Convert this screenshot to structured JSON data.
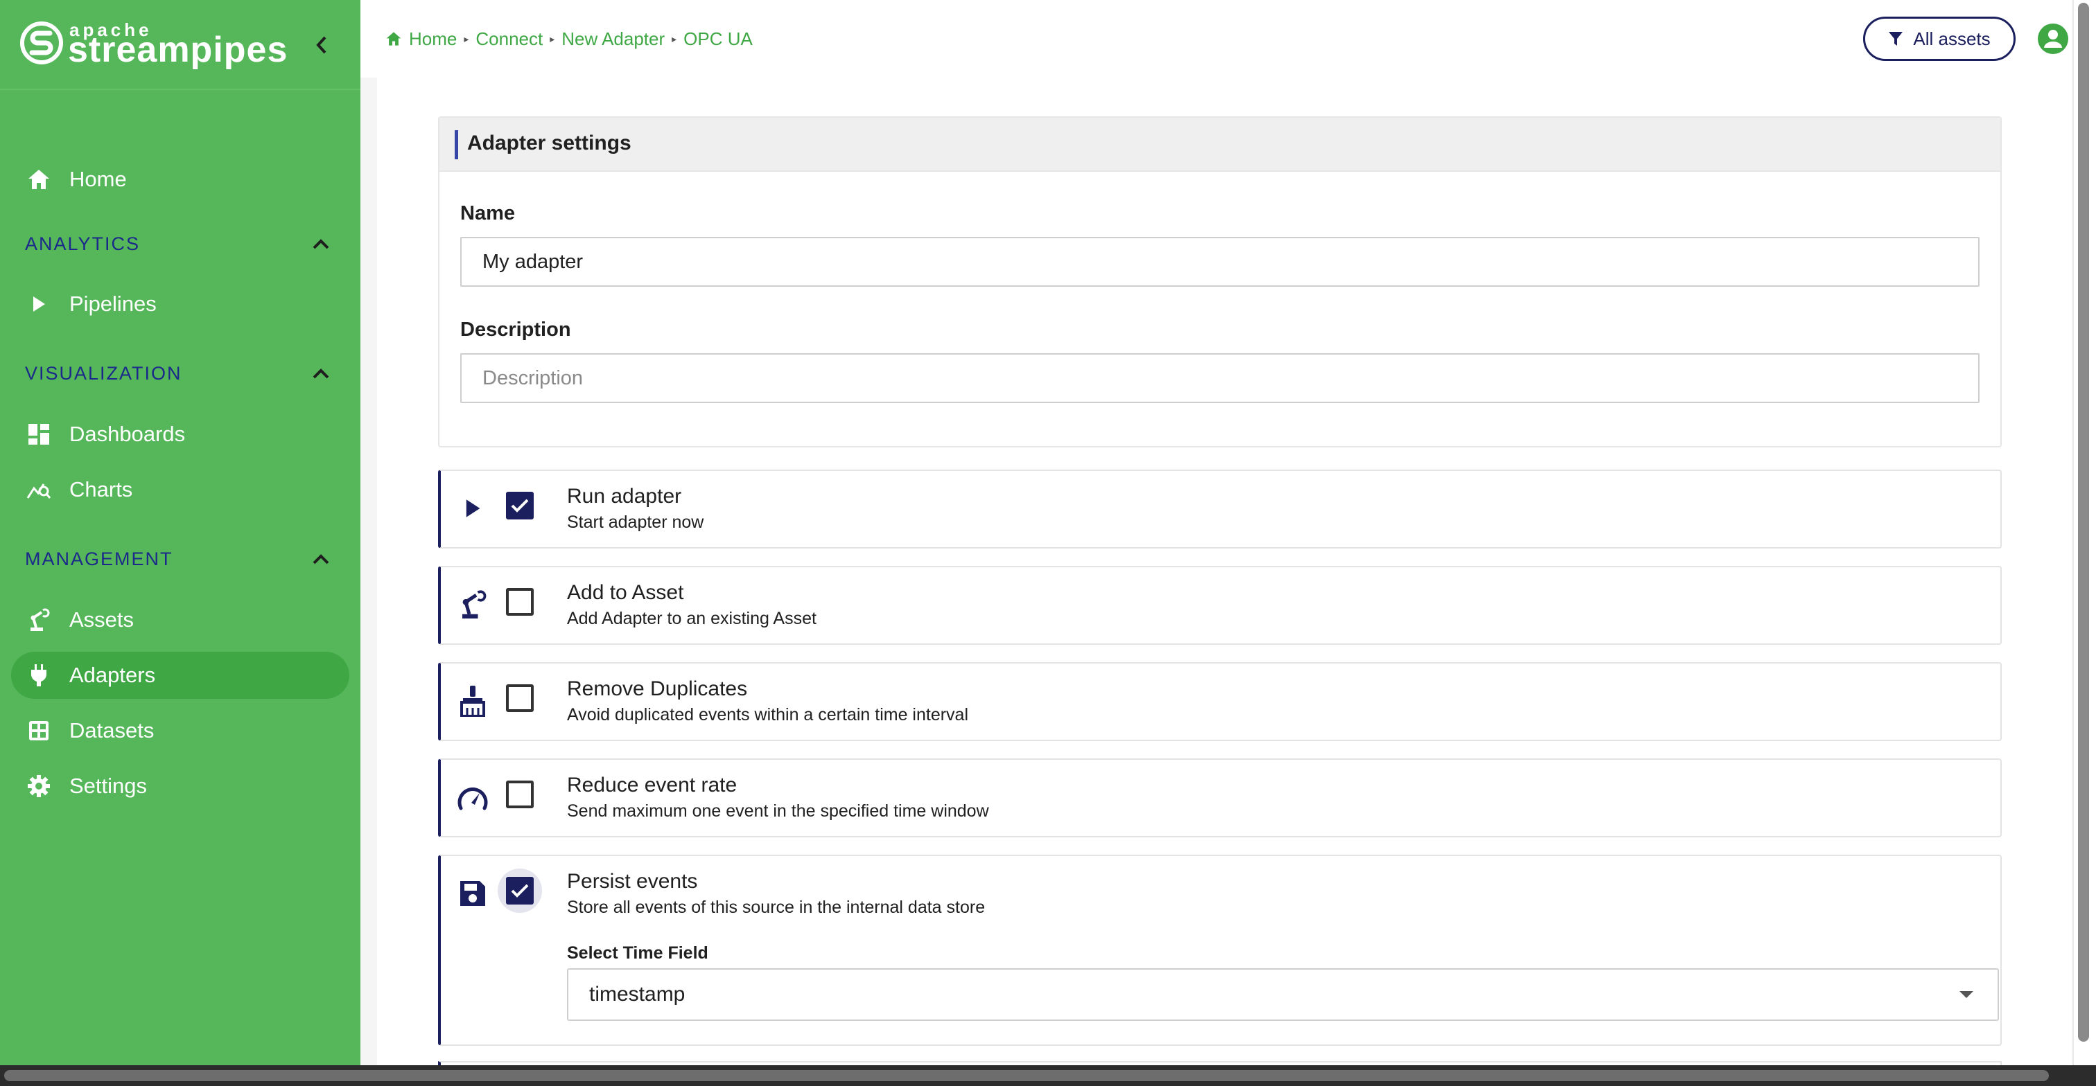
{
  "brand": {
    "top": "apache",
    "name": "streampipes"
  },
  "sidebar": {
    "home": "Home",
    "sections": {
      "analytics": "ANALYTICS",
      "visualization": "VISUALIZATION",
      "management": "MANAGEMENT"
    },
    "items": {
      "pipelines": "Pipelines",
      "dashboards": "Dashboards",
      "charts": "Charts",
      "assets": "Assets",
      "adapters": "Adapters",
      "datasets": "Datasets",
      "settings": "Settings"
    },
    "active_item": "Adapters"
  },
  "breadcrumb": [
    "Home",
    "Connect",
    "New Adapter",
    "OPC UA"
  ],
  "toolbar": {
    "all_assets_label": "All assets"
  },
  "adapter_settings": {
    "title": "Adapter settings",
    "name_label": "Name",
    "name_value": "My adapter",
    "description_label": "Description",
    "description_placeholder": "Description"
  },
  "options": {
    "run_adapter": {
      "title": "Run adapter",
      "desc": "Start adapter now",
      "checked": true
    },
    "add_to_asset": {
      "title": "Add to Asset",
      "desc": "Add Adapter to an existing Asset",
      "checked": false
    },
    "remove_duplicates": {
      "title": "Remove Duplicates",
      "desc": "Avoid duplicated events within a certain time interval",
      "checked": false
    },
    "reduce_event_rate": {
      "title": "Reduce event rate",
      "desc": "Send maximum one event in the specified time window",
      "checked": false
    },
    "persist_events": {
      "title": "Persist events",
      "desc": "Store all events of this source in the internal data store",
      "checked": true,
      "time_field_label": "Select Time Field",
      "time_field_value": "timestamp"
    }
  },
  "colors": {
    "sidebar_bg": "#55b75a",
    "sidebar_active": "#3fa845",
    "accent_dark": "#1b1f5e",
    "section_label": "#1b2a8a"
  }
}
